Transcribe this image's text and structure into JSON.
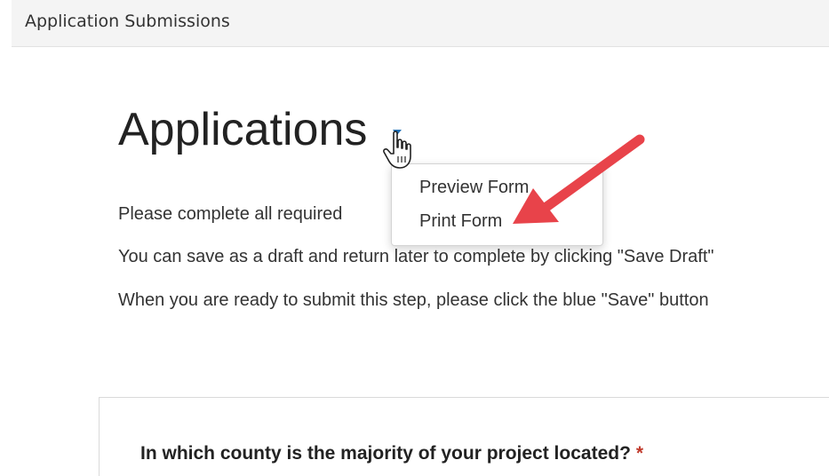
{
  "header": {
    "title": "Application Submissions"
  },
  "page": {
    "title": "Applications"
  },
  "dropdown": {
    "items": [
      {
        "label": "Preview Form"
      },
      {
        "label": "Print Form"
      }
    ]
  },
  "instructions": [
    "Please complete all required",
    "You can save as a draft and return later to complete by clicking \"Save Draft\"",
    "When you are ready to submit this step, please click the blue \"Save\" button"
  ],
  "form": {
    "question": "In which county is the majority of your project located?",
    "required_marker": "*"
  },
  "colors": {
    "arrow": "#e8434a",
    "caret": "#1f6fb5",
    "required": "#c0392b"
  }
}
